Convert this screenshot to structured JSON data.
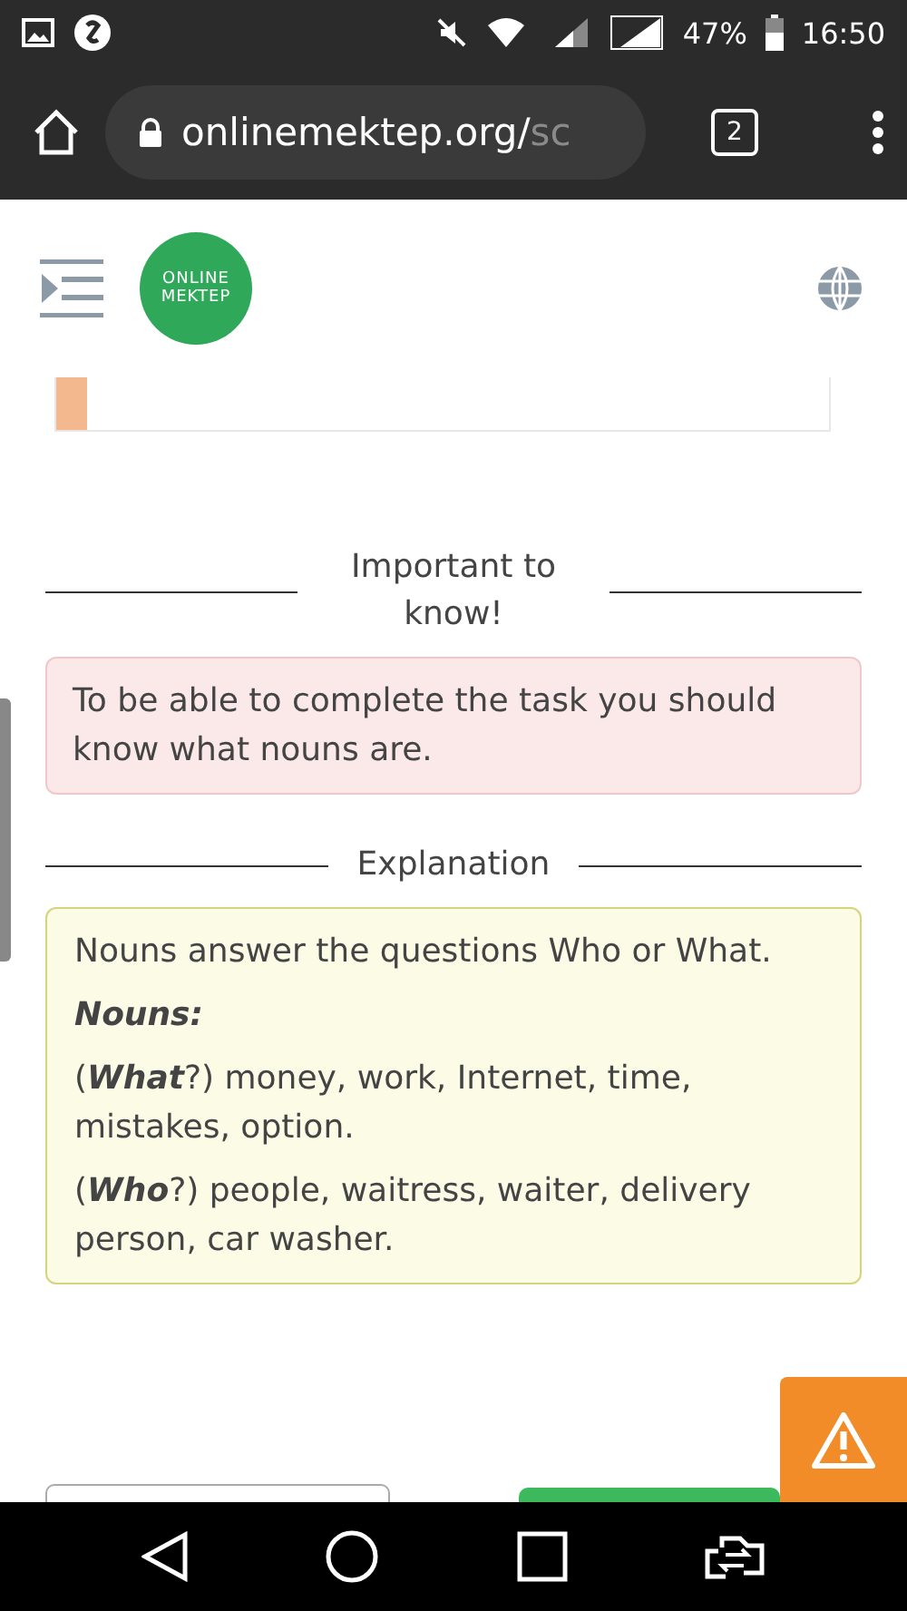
{
  "status_bar": {
    "battery": "47%",
    "time": "16:50"
  },
  "browser": {
    "url": "onlinemektep.org/",
    "url_faded": "sc",
    "tab_count": "2"
  },
  "header": {
    "logo": [
      "ONLINE",
      "MEKTEP"
    ]
  },
  "sections": [
    {
      "title": "Important to know!",
      "kind": "note",
      "paragraphs": [
        {
          "kind": "text",
          "text": "To be able to complete the task you should know what nouns are."
        }
      ]
    },
    {
      "title": "Explanation",
      "kind": "explain",
      "paragraphs": [
        {
          "kind": "text",
          "text": "Nouns answer the questions Who or What."
        },
        {
          "kind": "heading",
          "text": "Nouns:"
        },
        {
          "kind": "text",
          "text": "(**What**?) money, work, Internet, time, mistakes, option."
        },
        {
          "kind": "text",
          "text": "(**Who**?) people, waitress, waiter, delivery person, car washer."
        }
      ]
    }
  ]
}
